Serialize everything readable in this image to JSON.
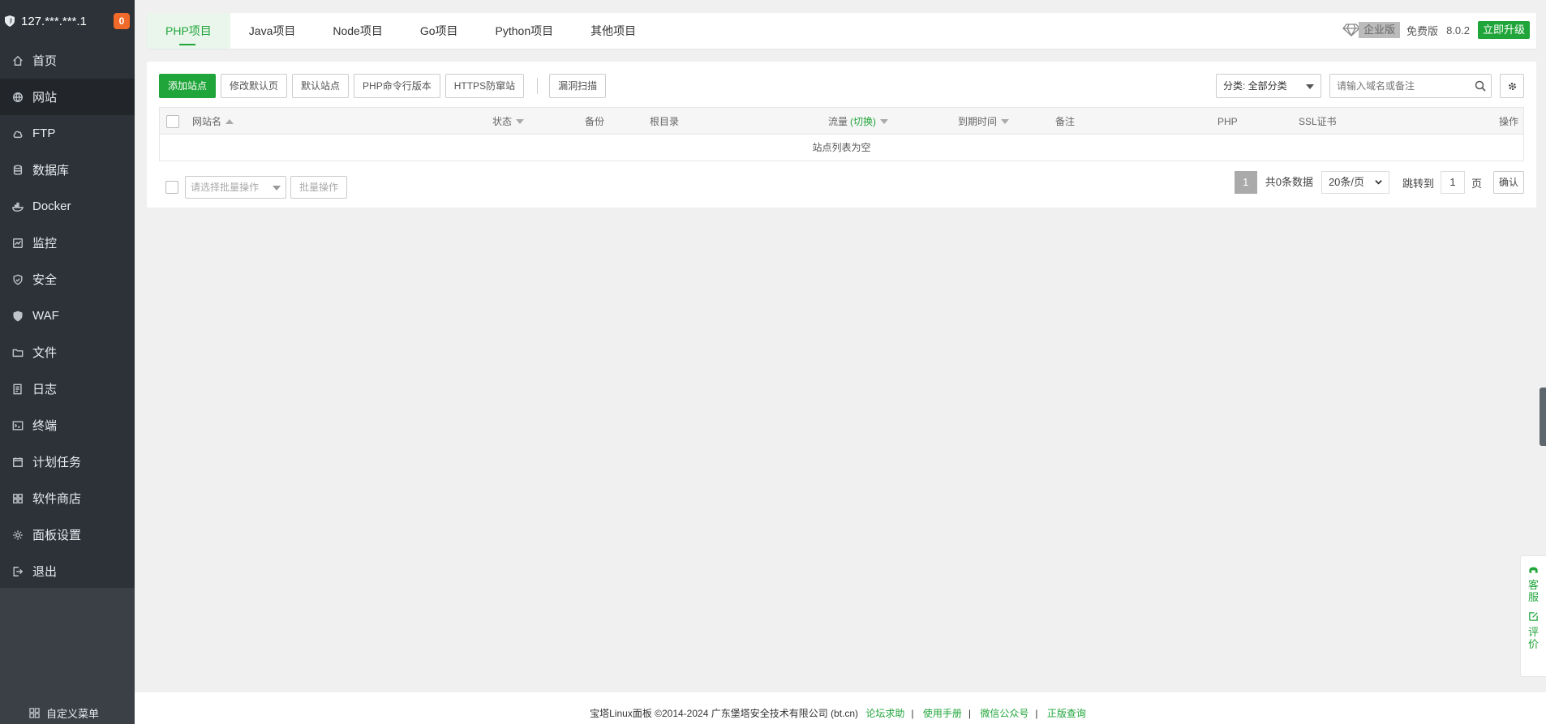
{
  "sidebar": {
    "server_ip": "127.***.***.1",
    "badge_count": "0",
    "items": [
      {
        "label": "首页",
        "icon": "home-icon"
      },
      {
        "label": "网站",
        "icon": "globe-icon"
      },
      {
        "label": "FTP",
        "icon": "ftp-icon"
      },
      {
        "label": "数据库",
        "icon": "database-icon"
      },
      {
        "label": "Docker",
        "icon": "docker-icon"
      },
      {
        "label": "监控",
        "icon": "monitor-icon"
      },
      {
        "label": "安全",
        "icon": "shield-icon"
      },
      {
        "label": "WAF",
        "icon": "waf-icon"
      },
      {
        "label": "文件",
        "icon": "folder-icon"
      },
      {
        "label": "日志",
        "icon": "log-icon"
      },
      {
        "label": "终端",
        "icon": "terminal-icon"
      },
      {
        "label": "计划任务",
        "icon": "calendar-icon"
      },
      {
        "label": "软件商店",
        "icon": "apps-icon"
      },
      {
        "label": "面板设置",
        "icon": "gear-icon"
      },
      {
        "label": "退出",
        "icon": "logout-icon"
      }
    ],
    "custom_menu_label": "自定义菜单"
  },
  "topbar": {
    "tabs": [
      {
        "label": "PHP项目"
      },
      {
        "label": "Java项目"
      },
      {
        "label": "Node项目"
      },
      {
        "label": "Go项目"
      },
      {
        "label": "Python项目"
      },
      {
        "label": "其他项目"
      }
    ],
    "enterprise_label": "企业版",
    "free_label": "免费版",
    "version": "8.0.2",
    "upgrade_label": "立即升级"
  },
  "toolbar": {
    "buttons": [
      {
        "label": "添加站点"
      },
      {
        "label": "修改默认页"
      },
      {
        "label": "默认站点"
      },
      {
        "label": "PHP命令行版本"
      },
      {
        "label": "HTTPS防窜站"
      },
      {
        "label": "漏洞扫描"
      }
    ],
    "category_select": "分类: 全部分类",
    "search_placeholder": "请输入域名或备注"
  },
  "table": {
    "columns": {
      "name": "网站名",
      "status": "状态",
      "backup": "备份",
      "root": "根目录",
      "traffic": "流量",
      "traffic_switch": "(切换)",
      "expire": "到期时间",
      "remark": "备注",
      "php": "PHP",
      "ssl": "SSL证书",
      "actions": "操作"
    },
    "empty_text": "站点列表为空"
  },
  "footer_row": {
    "batch_placeholder": "请选择批量操作",
    "batch_button": "批量操作",
    "current_page": "1",
    "total_text": "共0条数据",
    "per_page": "20条/页",
    "jump_label": "跳转到",
    "jump_value": "1",
    "page_unit": "页",
    "confirm_label": "确认"
  },
  "bottom_footer": {
    "copyright": "宝塔Linux面板 ©2014-2024 广东堡塔安全技术有限公司 (bt.cn)",
    "links": [
      "论坛求助",
      "使用手册",
      "微信公众号",
      "正版查询"
    ]
  },
  "float": {
    "service_label": "客服",
    "review_label": "评价"
  },
  "colors": {
    "accent": "#20a53a",
    "sidebar_bg": "#2d3238",
    "badge": "#f26a2a"
  }
}
